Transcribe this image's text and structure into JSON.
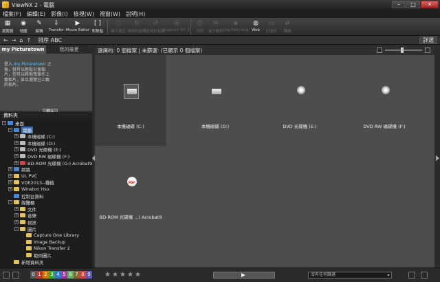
{
  "window": {
    "title": "ViewNX 2 - 電腦",
    "minimize": "–",
    "maximize": "□",
    "close": "✕"
  },
  "menu": [
    "檔案(F)",
    "編輯(E)",
    "影像(I)",
    "檢視(W)",
    "視窗(W)",
    "說明(H)"
  ],
  "toolbar": [
    {
      "label": "瀏覽器",
      "icon": "▦",
      "dim": false,
      "cls": "tb"
    },
    {
      "label": "地圖",
      "icon": "◉",
      "dim": false,
      "cls": "tb"
    },
    {
      "label": "編輯",
      "icon": "✎",
      "dim": false,
      "cls": "tb"
    },
    {
      "label": "Transfer",
      "icon": "⇩",
      "dim": false,
      "cls": "tb wide"
    },
    {
      "label": "Movie Editor",
      "icon": "▶",
      "dim": false,
      "cls": "tb w2"
    },
    {
      "label": "對焦點",
      "icon": "[ ]",
      "dim": false,
      "cls": "tb"
    },
    {
      "label": "顯示選定",
      "icon": "◌",
      "dim": true,
      "cls": "tb wide"
    },
    {
      "label": "順時針旋轉",
      "icon": "↻",
      "dim": true,
      "cls": "tb wide"
    },
    {
      "label": "逆時針旋轉",
      "icon": "↺",
      "dim": true,
      "cls": "tb wide"
    },
    {
      "label": "Capture NX 2",
      "icon": "◎",
      "dim": true,
      "cls": "tb w2"
    },
    {
      "label": "列印",
      "icon": "⎙",
      "dim": true,
      "cls": "tb"
    },
    {
      "label": "電子郵件",
      "icon": "✉",
      "dim": true,
      "cls": "tb"
    },
    {
      "label": "Log Matching",
      "icon": "◈",
      "dim": true,
      "cls": "tb w2"
    },
    {
      "label": "Web",
      "icon": "◍",
      "dim": false,
      "cls": "tb"
    },
    {
      "label": "幻燈片",
      "icon": "▭",
      "dim": true,
      "cls": "tb"
    },
    {
      "label": "轉換",
      "icon": "⇄",
      "dim": true,
      "cls": "tb"
    }
  ],
  "subbar": {
    "back": "←",
    "forward": "→",
    "home": "⌂",
    "up": "↑",
    "sort_label": "排序 ABC",
    "settings": "詳選"
  },
  "left": {
    "tab_active": "my Picturetown",
    "tab_other": "我的最愛",
    "pt_pre": "登入 ",
    "pt_link": "my Picturetown",
    "pt_post": " 之後，就可以輕鬆分享相片，您可以將拖曳操作上載相片，並且瀏覽已上載的相片。",
    "login_button": "登入",
    "folder_header": "資料夾",
    "tree": [
      {
        "name": "桌面",
        "indent": 0,
        "exp": "-",
        "icon": "blue",
        "sel": false
      },
      {
        "name": "電腦",
        "indent": 1,
        "exp": "-",
        "icon": "blue",
        "sel": true
      },
      {
        "name": "本機磁碟 (C:)",
        "indent": 2,
        "exp": "+",
        "icon": "gray",
        "sel": false
      },
      {
        "name": "本機磁碟 (D:)",
        "indent": 2,
        "exp": "+",
        "icon": "gray",
        "sel": false
      },
      {
        "name": "DVD 光碟機 (E:)",
        "indent": 2,
        "exp": "+",
        "icon": "gray",
        "sel": false
      },
      {
        "name": "DVD RW 磁碟機 (F:)",
        "indent": 2,
        "exp": "+",
        "icon": "gray",
        "sel": false
      },
      {
        "name": "BD-ROM 光碟機 (G:) Acrobat9",
        "indent": 2,
        "exp": "+",
        "icon": "red",
        "sel": false
      },
      {
        "name": "網路",
        "indent": 1,
        "exp": "+",
        "icon": "blue",
        "sel": false
      },
      {
        "name": "UL PVC",
        "indent": 1,
        "exp": "+",
        "icon": "yellow",
        "sel": false
      },
      {
        "name": "VDE2013--種植",
        "indent": 1,
        "exp": "+",
        "icon": "yellow",
        "sel": false
      },
      {
        "name": "Winston Hsu",
        "indent": 1,
        "exp": "+",
        "icon": "yellow",
        "sel": false
      },
      {
        "name": "控制台資料",
        "indent": 1,
        "exp": "none",
        "icon": "blue",
        "sel": false
      },
      {
        "name": "媒體櫃",
        "indent": 1,
        "exp": "-",
        "icon": "yellow",
        "sel": false
      },
      {
        "name": "文件",
        "indent": 2,
        "exp": "+",
        "icon": "yellow",
        "sel": false
      },
      {
        "name": "音樂",
        "indent": 2,
        "exp": "+",
        "icon": "yellow",
        "sel": false
      },
      {
        "name": "視訊",
        "indent": 2,
        "exp": "+",
        "icon": "yellow",
        "sel": false
      },
      {
        "name": "圖片",
        "indent": 2,
        "exp": "-",
        "icon": "yellow",
        "sel": false
      },
      {
        "name": "Capture One Library",
        "indent": 3,
        "exp": "none",
        "icon": "yellow",
        "sel": false
      },
      {
        "name": "Image Backup",
        "indent": 3,
        "exp": "none",
        "icon": "yellow",
        "sel": false
      },
      {
        "name": "Nikon Transfer 2",
        "indent": 3,
        "exp": "none",
        "icon": "yellow",
        "sel": false
      },
      {
        "name": "範例圖片",
        "indent": 3,
        "exp": "none",
        "icon": "yellow",
        "sel": false
      },
      {
        "name": "新增資料夾",
        "indent": 1,
        "exp": "none",
        "icon": "yellow",
        "sel": false
      }
    ]
  },
  "main": {
    "status": "選擇的: 0 個檔案 | 未篩選: (已顯示 0 個檔案)",
    "cells": [
      {
        "label": "本機磁碟 (C:)",
        "icon": "drive",
        "selected": true
      },
      {
        "label": "本機磁碟 (D:)",
        "icon": "drive",
        "selected": false
      },
      {
        "label": "DVD 光碟機 (E:)",
        "icon": "disc",
        "selected": false
      },
      {
        "label": "DVD RW 磁碟機 (F:)",
        "icon": "disc",
        "selected": false
      },
      {
        "label": "BD-ROM 光碟機 ...) Acrobat9",
        "icon": "bd",
        "selected": false
      }
    ]
  },
  "bottom": {
    "labels": [
      "0",
      "1",
      "2",
      "3",
      "4",
      "5",
      "6",
      "7",
      "8",
      "9"
    ],
    "label_colors": [
      "#555",
      "#b33",
      "#c70",
      "#3a3",
      "#37c",
      "#a3a",
      "#6a6",
      "#863",
      "#c44",
      "#55c"
    ],
    "stars": [
      "★",
      "★",
      "★",
      "★",
      "★"
    ],
    "filter_select": "沒有任何篩選"
  }
}
